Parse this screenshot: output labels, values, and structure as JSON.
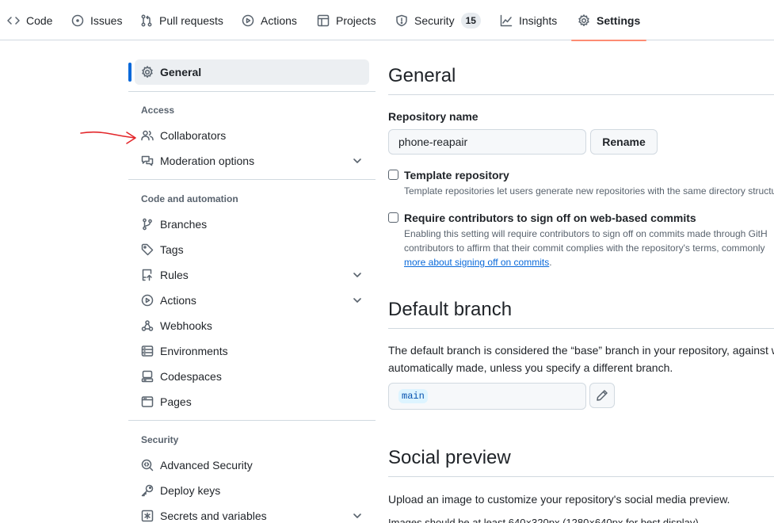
{
  "topnav": {
    "tabs": [
      {
        "label": "Code",
        "icon": "code-icon"
      },
      {
        "label": "Issues",
        "icon": "issue-icon"
      },
      {
        "label": "Pull requests",
        "icon": "pull-request-icon"
      },
      {
        "label": "Actions",
        "icon": "play-icon"
      },
      {
        "label": "Projects",
        "icon": "table-icon"
      },
      {
        "label": "Security",
        "icon": "shield-icon",
        "count": "15"
      },
      {
        "label": "Insights",
        "icon": "graph-icon"
      },
      {
        "label": "Settings",
        "icon": "gear-icon",
        "active": true
      }
    ]
  },
  "sidebar": {
    "general": "General",
    "access_heading": "Access",
    "collaborators": "Collaborators",
    "moderation": "Moderation options",
    "code_heading": "Code and automation",
    "branches": "Branches",
    "tags": "Tags",
    "rules": "Rules",
    "actions": "Actions",
    "webhooks": "Webhooks",
    "environments": "Environments",
    "codespaces": "Codespaces",
    "pages": "Pages",
    "security_heading": "Security",
    "advanced_security": "Advanced Security",
    "deploy_keys": "Deploy keys",
    "secrets": "Secrets and variables"
  },
  "main": {
    "general_title": "General",
    "repo_name_label": "Repository name",
    "repo_name_value": "phone-reapair",
    "rename_button": "Rename",
    "template_title": "Template repository",
    "template_desc": "Template repositories let users generate new repositories with the same directory structu",
    "signoff_title": "Require contributors to sign off on web-based commits",
    "signoff_desc_1": "Enabling this setting will require contributors to sign off on commits made through GitH",
    "signoff_desc_2": "contributors to affirm that their commit complies with the repository's terms, commonly",
    "signoff_link": "more about signing off on commits",
    "signoff_period": ".",
    "default_branch_title": "Default branch",
    "default_branch_desc_1": "The default branch is considered the “base” branch in your repository, against w",
    "default_branch_desc_2": "automatically made, unless you specify a different branch.",
    "default_branch_value": "main",
    "social_title": "Social preview",
    "social_desc": "Upload an image to customize your repository's social media preview.",
    "social_desc_2": "Images should be at least 640×320px (1280×640px for best display)."
  },
  "colors": {
    "accent": "#0969da",
    "tab_underline": "#fd8c73",
    "annotation_arrow": "#e3262a"
  }
}
